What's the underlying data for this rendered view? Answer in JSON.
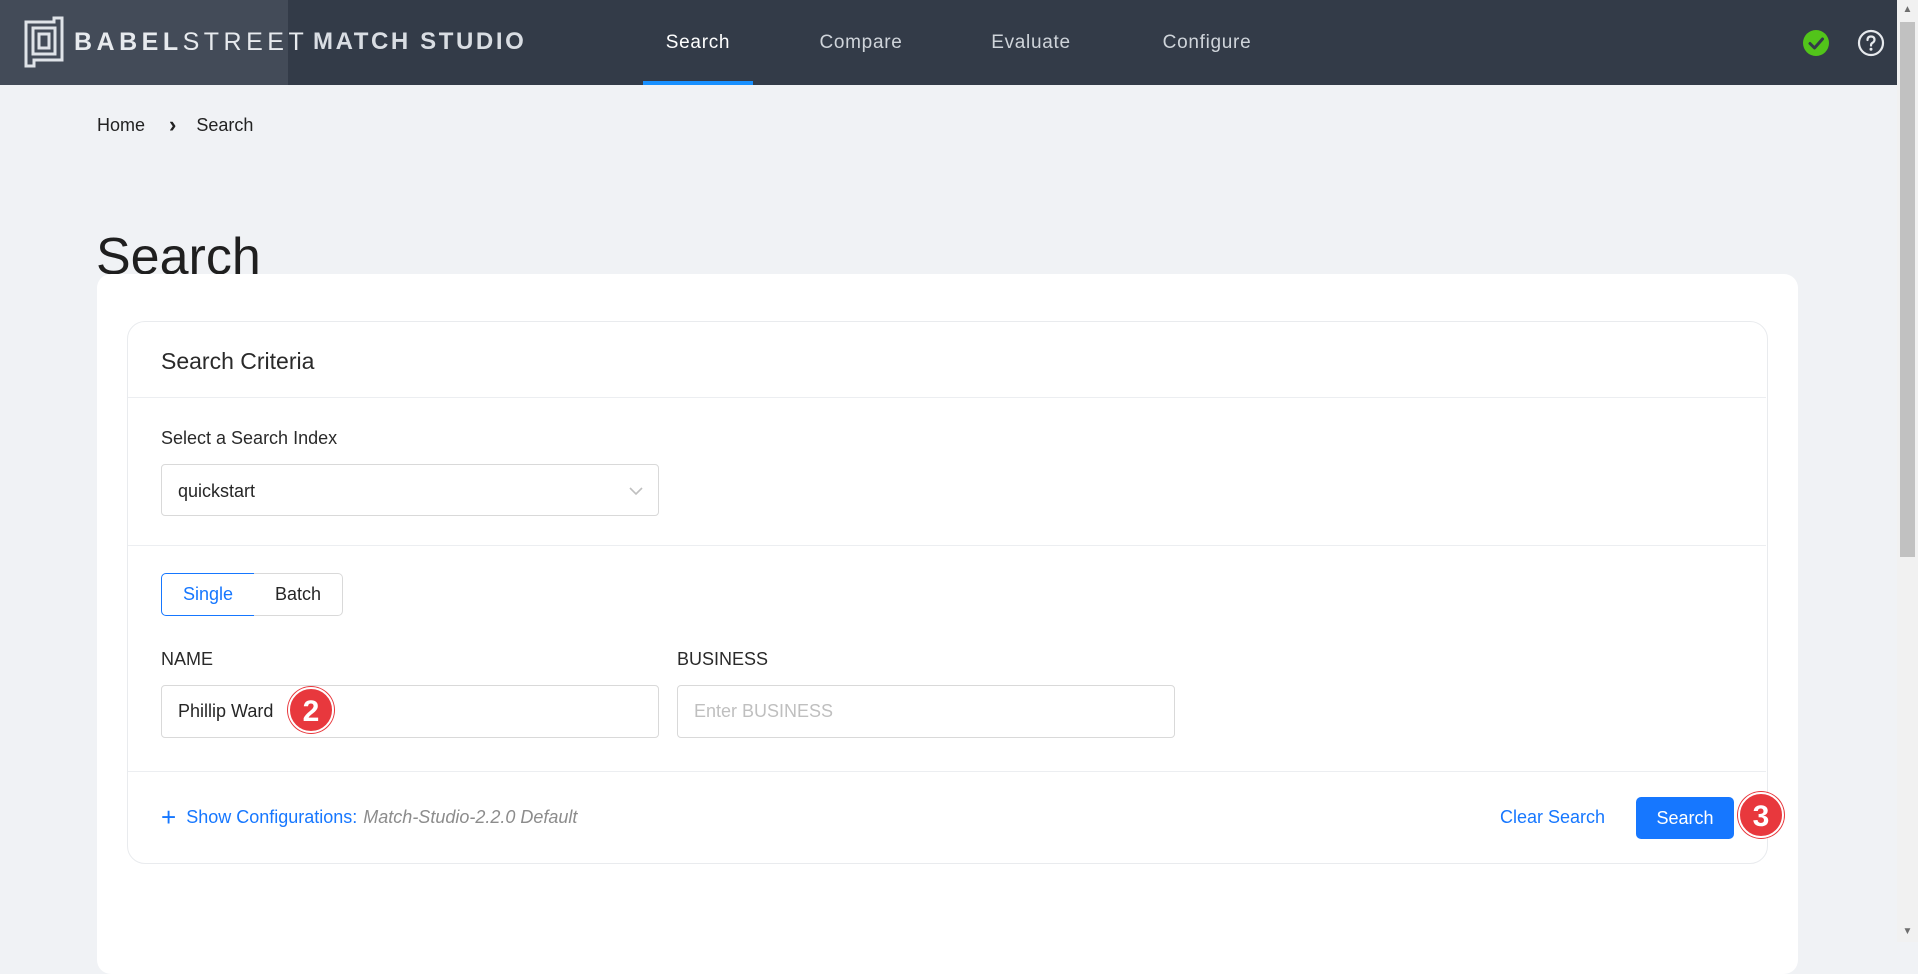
{
  "header": {
    "logo_light": "BABEL",
    "logo_bold": "STREET",
    "app_title": "MATCH STUDIO",
    "nav": [
      {
        "label": "Search",
        "active": true
      },
      {
        "label": "Compare",
        "active": false
      },
      {
        "label": "Evaluate",
        "active": false
      },
      {
        "label": "Configure",
        "active": false
      }
    ],
    "status_icon": "check-circle-icon",
    "help_icon": "question-circle-icon",
    "accent_color": "#1890ff",
    "status_color": "#52c41a"
  },
  "breadcrumb": {
    "home": "Home",
    "current": "Search"
  },
  "page_title": "Search",
  "search_criteria": {
    "title": "Search Criteria",
    "index_label": "Select a Search Index",
    "index_value": "quickstart",
    "mode_single": "Single",
    "mode_batch": "Batch",
    "selected_mode": "Single",
    "name_label": "NAME",
    "name_value": "Phillip Ward",
    "business_label": "BUSINESS",
    "business_placeholder": "Enter BUSINESS",
    "show_configurations": "Show Configurations:",
    "configuration_name": "Match-Studio-2.2.0 Default",
    "clear_search": "Clear Search",
    "search_button": "Search"
  },
  "annotations": {
    "badge_2": "2",
    "badge_3": "3",
    "badge_color": "#e8383d"
  }
}
